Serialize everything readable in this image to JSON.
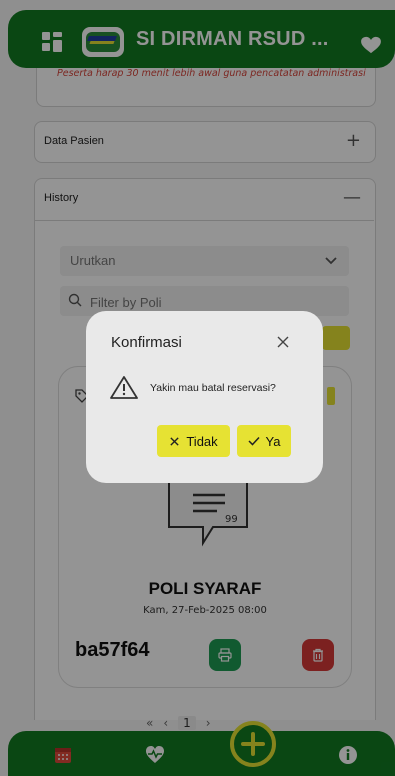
{
  "header": {
    "title": "SI DIRMAN RSUD ...",
    "menu_icon": "grid-icon",
    "logo": "app-logo",
    "favorite_icon": "heart-icon"
  },
  "notice": {
    "text": "Peserta harap 30 menit lebih awal guna pencatatan administrasi"
  },
  "sections": {
    "data_pasien": {
      "label": "Data Pasien",
      "toggle": "+"
    },
    "history": {
      "label": "History",
      "toggle": "—"
    }
  },
  "history": {
    "sort_placeholder": "Urutkan",
    "filter_placeholder": "Filter by Poli",
    "card": {
      "poli": "POLI SYARAF",
      "date": "Kam, 27-Feb-2025 08:00",
      "code": "ba57f64"
    },
    "pager": {
      "first": "«",
      "prev": "‹",
      "current": "1",
      "next": "›"
    }
  },
  "dialog": {
    "title": "Konfirmasi",
    "message": "Yakin mau batal reservasi?",
    "no_label": "Tidak",
    "yes_label": "Ya"
  },
  "bottom_nav": {
    "items": [
      "calendar-icon",
      "heartbeat-icon",
      "add-icon",
      "info-icon"
    ]
  },
  "colors": {
    "primary_green": "#127a22",
    "accent_yellow": "#e6e233",
    "danger_red": "#d63a38",
    "success_green": "#1e9c53"
  }
}
